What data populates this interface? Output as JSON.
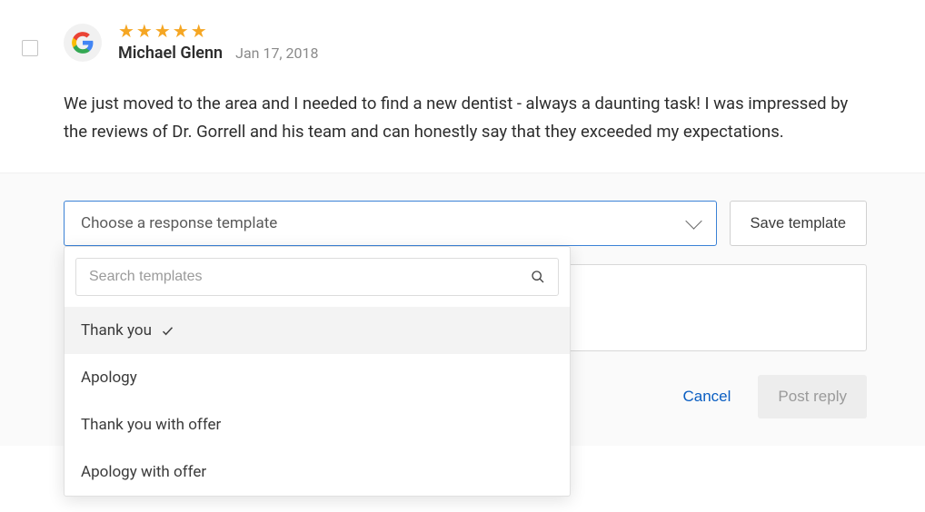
{
  "review": {
    "source": "Google",
    "stars": "★★★★★",
    "author": "Michael Glenn",
    "date": "Jan 17, 2018",
    "text": "We just moved to the area and I needed to find a new dentist - always a daunting task! I was impressed by the reviews of Dr. Gorrell and his team and can honestly say that they exceeded my expectations."
  },
  "reply": {
    "template_select_label": "Choose a response template",
    "save_template_label": "Save template",
    "search_placeholder": "Search templates",
    "options": [
      {
        "label": "Thank you",
        "selected": true
      },
      {
        "label": "Apology",
        "selected": false
      },
      {
        "label": "Thank you with offer",
        "selected": false
      },
      {
        "label": "Apology with offer",
        "selected": false
      }
    ],
    "cancel_label": "Cancel",
    "post_label": "Post reply"
  }
}
